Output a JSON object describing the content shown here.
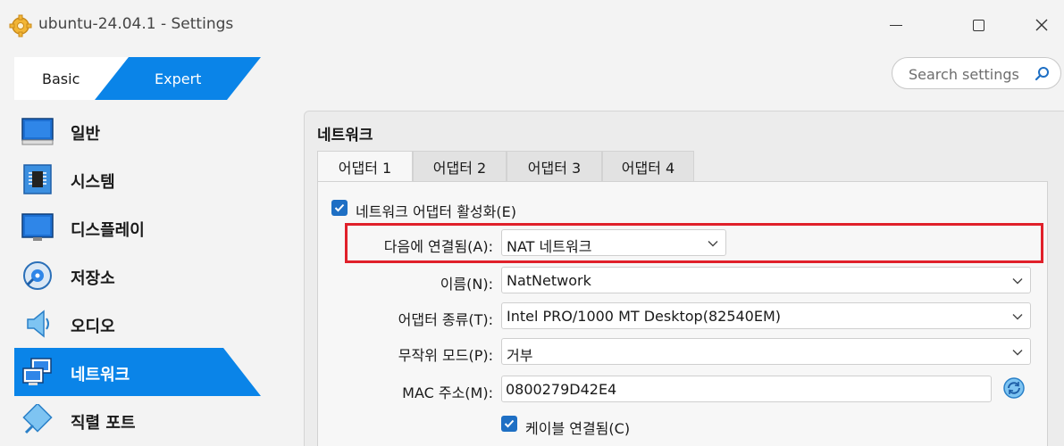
{
  "window": {
    "title": "ubuntu-24.04.1 - Settings"
  },
  "mode": {
    "basic_label": "Basic",
    "expert_label": "Expert",
    "selected": "Expert"
  },
  "search": {
    "placeholder": "Search settings"
  },
  "sidebar": {
    "items": [
      {
        "label": "일반",
        "icon": "general-icon"
      },
      {
        "label": "시스템",
        "icon": "chip-icon"
      },
      {
        "label": "디스플레이",
        "icon": "monitor-icon"
      },
      {
        "label": "저장소",
        "icon": "disk-icon"
      },
      {
        "label": "오디오",
        "icon": "speaker-icon"
      },
      {
        "label": "네트워크",
        "icon": "network-icon",
        "active": true
      },
      {
        "label": "직렬 포트",
        "icon": "serial-port-icon"
      }
    ]
  },
  "main": {
    "title": "네트워크",
    "tabs": [
      {
        "label": "어댑터 1",
        "active": true
      },
      {
        "label": "어댑터 2"
      },
      {
        "label": "어댑터 3"
      },
      {
        "label": "어댑터 4"
      }
    ],
    "enable_adapter": {
      "label": "네트워크 어댑터 활성화(E)",
      "checked": true
    },
    "attached_to": {
      "label": "다음에 연결됨(A):",
      "value": "NAT 네트워크"
    },
    "name": {
      "label": "이름(N):",
      "value": "NatNetwork"
    },
    "adapter_type": {
      "label": "어댑터 종류(T):",
      "value": "Intel PRO/1000 MT Desktop(82540EM)"
    },
    "promiscuous_mode": {
      "label": "무작위 모드(P):",
      "value": "거부"
    },
    "mac_address": {
      "label": "MAC 주소(M):",
      "value": "0800279D42E4"
    },
    "cable_connected": {
      "label": "케이블 연결됨(C)",
      "checked": true
    }
  },
  "colors": {
    "accent": "#1e6fc4",
    "active_blue": "#0a84e8",
    "highlight_red": "#e0202a"
  }
}
